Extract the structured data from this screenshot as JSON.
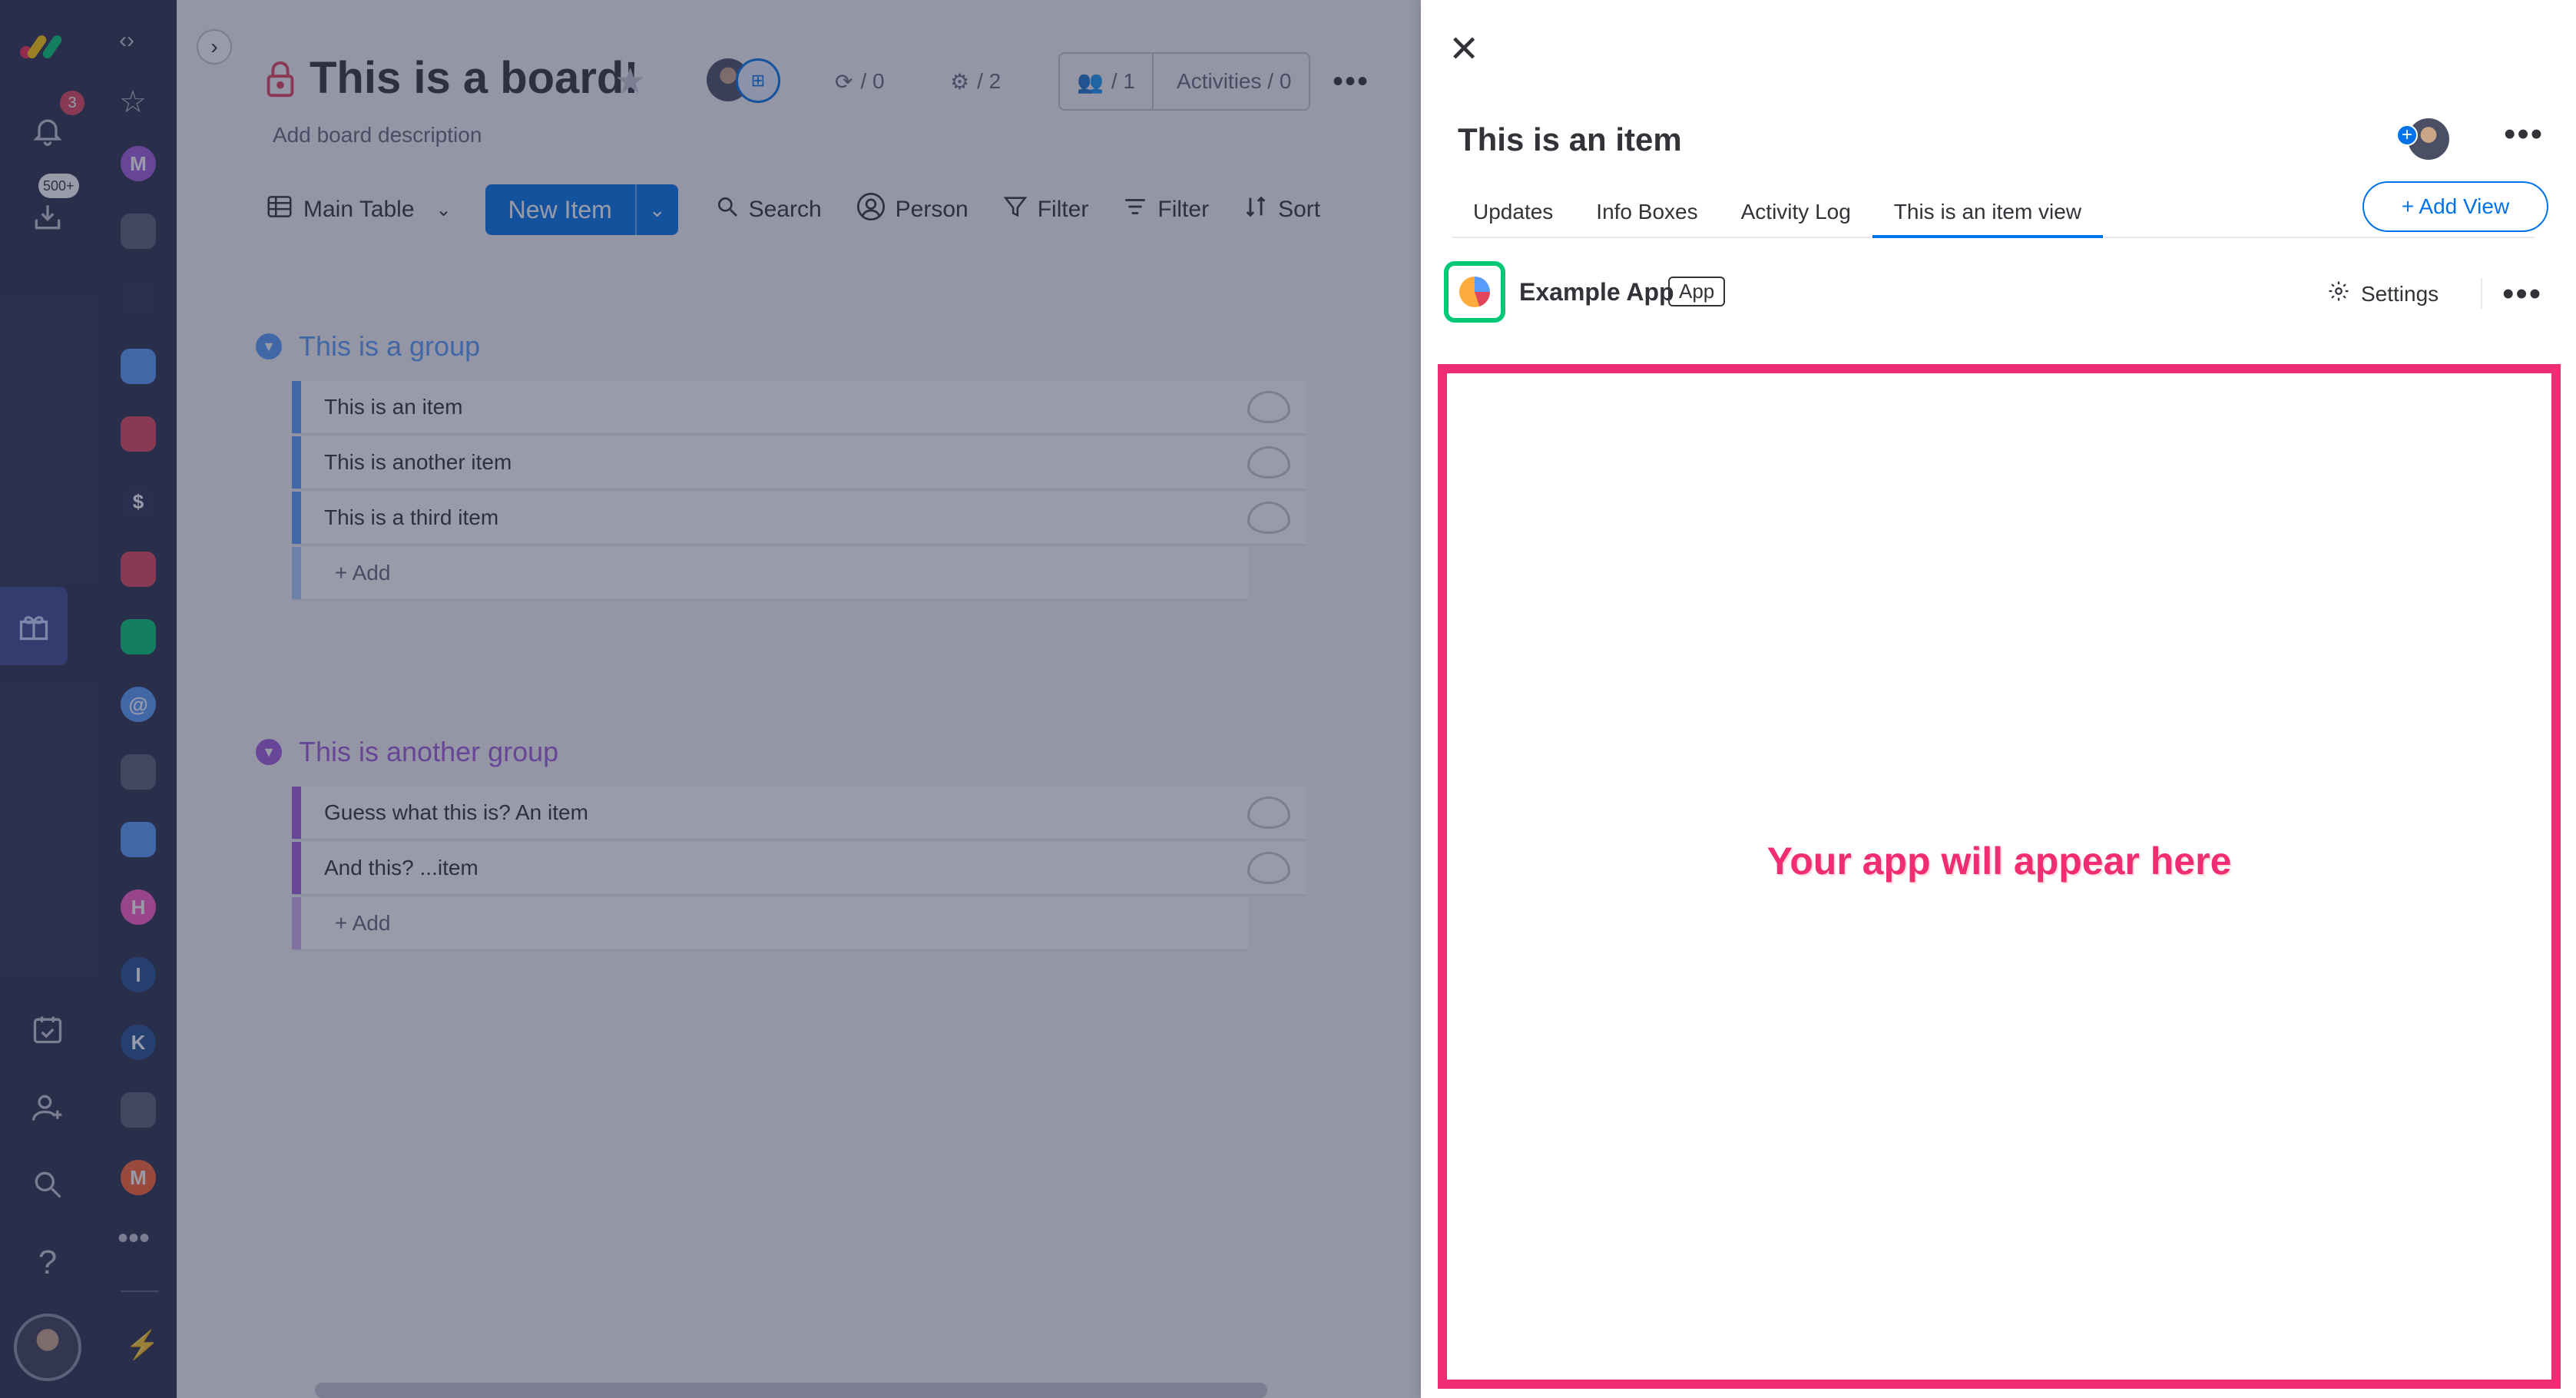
{
  "nav": {
    "notifications_badge": "3",
    "inbox_badge": "500+"
  },
  "workspaces": [
    {
      "letter": "M",
      "color": "#a25ddc"
    },
    {
      "letter": "",
      "color": "#5c5f73"
    },
    {
      "letter": "",
      "color": "#2b3151"
    },
    {
      "letter": "",
      "color": "#579bfc"
    },
    {
      "letter": "",
      "color": "#e2445c"
    },
    {
      "letter": "$",
      "color": "#2b3151"
    },
    {
      "letter": "",
      "color": "#e2445c"
    },
    {
      "letter": "",
      "color": "#00c875"
    },
    {
      "letter": "@",
      "color": "#579bfc"
    },
    {
      "letter": "",
      "color": "#5c5f73"
    },
    {
      "letter": "",
      "color": "#579bfc"
    },
    {
      "letter": "H",
      "color": "#ff5ac4"
    },
    {
      "letter": "I",
      "color": "#225091"
    },
    {
      "letter": "K",
      "color": "#225091"
    },
    {
      "letter": "",
      "color": "#5c5f73"
    },
    {
      "letter": "M",
      "color": "#ff642e"
    }
  ],
  "board": {
    "title": "This is a board!",
    "description": "Add board description",
    "integrations": "/ 0",
    "automations": "/ 2",
    "members": "/ 1",
    "activities": "Activities / 0",
    "toolbar": {
      "main_table": "Main Table",
      "new_item": "New Item",
      "search": "Search",
      "person": "Person",
      "filter1": "Filter",
      "filter2": "Filter",
      "sort": "Sort"
    },
    "groups": [
      {
        "title": "This is a group",
        "color": "#579bfc",
        "items": [
          "This is an item",
          "This is another item",
          "This is a third item"
        ],
        "add_label": "+ Add"
      },
      {
        "title": "This is another group",
        "color": "#a25ddc",
        "items": [
          "Guess what this is? An item",
          "And this? ...item"
        ],
        "add_label": "+ Add"
      }
    ]
  },
  "panel": {
    "item_title": "This is an item",
    "tabs": [
      "Updates",
      "Info Boxes",
      "Activity Log",
      "This is an item view"
    ],
    "add_view": "+ Add View",
    "app_name": "Example App",
    "app_badge": "App",
    "settings": "Settings",
    "app_message": "Your app will appear here"
  }
}
